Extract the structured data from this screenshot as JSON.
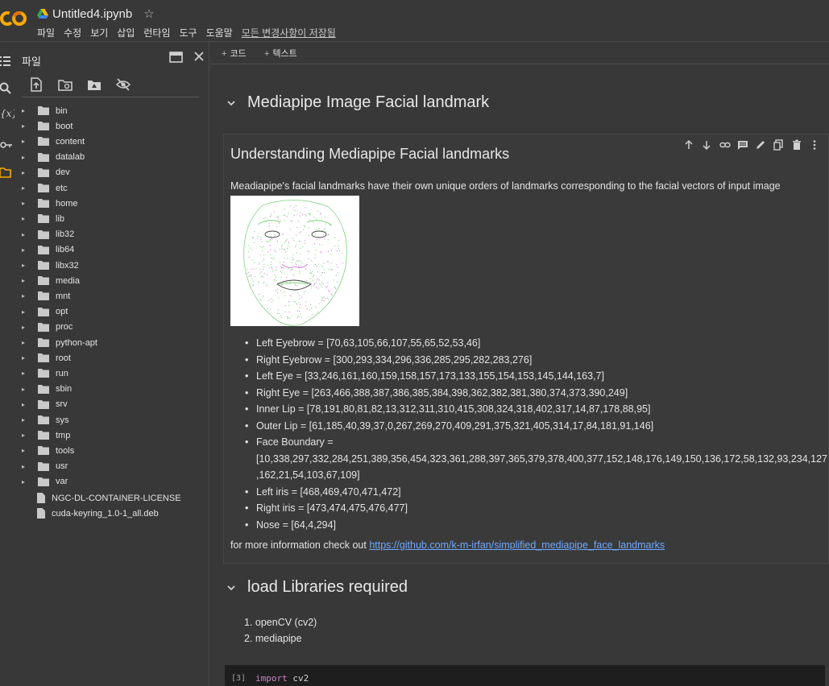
{
  "app": {
    "logo_text": "CO",
    "doc_title": "Untitled4.ipynb",
    "menu": [
      "파일",
      "수정",
      "보기",
      "삽입",
      "런타임",
      "도구",
      "도움말"
    ],
    "save_status": "모든 변경사항이 저장됨"
  },
  "colors": {
    "background": "#383838",
    "logo_orange": "#f9ab00",
    "logo_yellow": "#e8710a",
    "link": "#6ea8ff",
    "code_background": "#1e1e1e",
    "keyword": "#c586c0"
  },
  "rail": {
    "icons": [
      "table-of-contents-icon",
      "search-icon",
      "variables-icon",
      "secrets-key-icon",
      "folder-icon"
    ],
    "variables_glyph": "{x}"
  },
  "file_panel": {
    "title": "파일",
    "tools": [
      "upload-icon",
      "refresh-icon",
      "mount-drive-icon",
      "hide-files-icon"
    ],
    "folders": [
      "bin",
      "boot",
      "content",
      "datalab",
      "dev",
      "etc",
      "home",
      "lib",
      "lib32",
      "lib64",
      "libx32",
      "media",
      "mnt",
      "opt",
      "proc",
      "python-apt",
      "root",
      "run",
      "sbin",
      "srv",
      "sys",
      "tmp",
      "tools",
      "usr",
      "var"
    ],
    "files": [
      "NGC-DL-CONTAINER-LICENSE",
      "cuda-keyring_1.0-1_all.deb"
    ]
  },
  "notebook": {
    "add_code": "코드",
    "add_text": "텍스트",
    "section1_title": "Mediapipe Image Facial landmark",
    "cell_tools": [
      "move-up-icon",
      "move-down-icon",
      "link-icon",
      "comment-icon",
      "edit-icon",
      "mirror-cell-icon",
      "delete-icon",
      "more-icon"
    ],
    "cell_heading": "Understanding Mediapipe Facial landmarks",
    "cell_description": "Meadiapipe's facial landmarks have their own unique orders of landmarks corresponding to the facial vectors of input image",
    "landmarks": [
      "Left Eyebrow = [70,63,105,66,107,55,65,52,53,46]",
      "Right Eyebrow = [300,293,334,296,336,285,295,282,283,276]",
      "Left Eye = [33,246,161,160,159,158,157,173,133,155,154,153,145,144,163,7]",
      "Right Eye = [263,466,388,387,386,385,384,398,362,382,381,380,374,373,390,249]",
      "Inner Lip = [78,191,80,81,82,13,312,311,310,415,308,324,318,402,317,14,87,178,88,95]",
      "Outer Lip = [61,185,40,39,37,0,267,269,270,409,291,375,321,405,314,17,84,181,91,146]"
    ],
    "face_boundary_label": "Face Boundary =",
    "face_boundary_line1": "[10,338,297,332,284,251,389,356,454,323,361,288,397,365,379,378,400,377,152,148,176,149,150,136,172,58,132,93,234,127",
    "face_boundary_line2": ",162,21,54,103,67,109]",
    "landmarks_after": [
      "Left iris = [468,469,470,471,472]",
      "Right iris = [473,474,475,476,477]",
      "Nose = [64,4,294]"
    ],
    "more_info_prefix": "for more information check out",
    "more_info_link": "https://github.com/k-m-irfan/simplified_mediapipe_face_landmarks",
    "section2_title": "load Libraries required",
    "libraries": [
      "1. openCV (cv2)",
      "2. mediapipe"
    ],
    "code_cell": {
      "exec_count": "[3]",
      "keyword": "import",
      "rest": "cv2"
    }
  }
}
